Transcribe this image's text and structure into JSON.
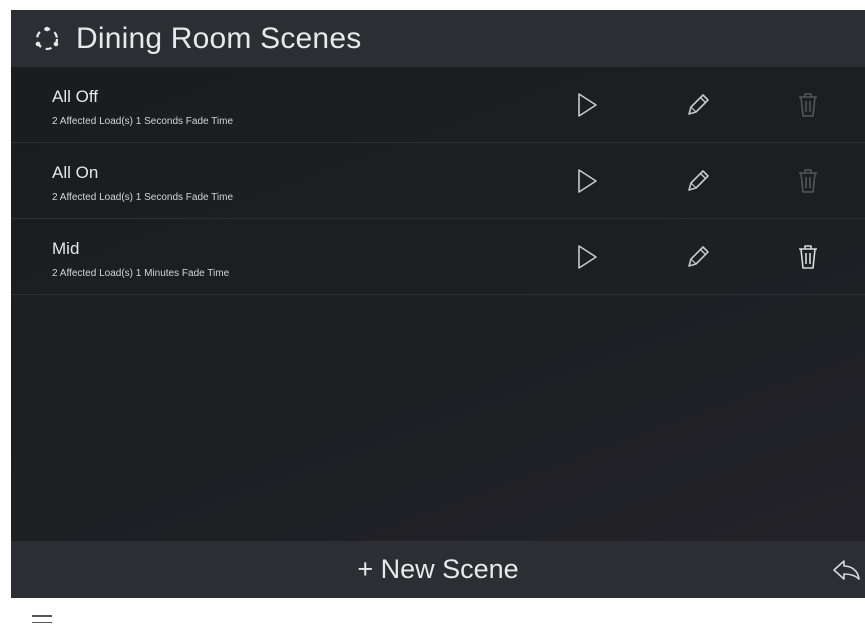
{
  "header": {
    "title": "Dining Room Scenes",
    "icon": "scenes-icon"
  },
  "scenes": [
    {
      "name": "All Off",
      "details": "2 Affected Load(s) 1 Seconds Fade Time",
      "delete_enabled": false
    },
    {
      "name": "All On",
      "details": "2 Affected Load(s) 1 Seconds Fade Time",
      "delete_enabled": false
    },
    {
      "name": "Mid",
      "details": "2 Affected Load(s) 1 Minutes Fade Time",
      "delete_enabled": true
    }
  ],
  "footer": {
    "new_scene_label": "+ New Scene",
    "back_icon": "back-arrow-icon"
  },
  "colors": {
    "background": "#1b1d21",
    "bar": "#2b2e33",
    "text": "#e8e8e8",
    "icon": "#c8c8c8",
    "icon_disabled": "#55575b"
  }
}
